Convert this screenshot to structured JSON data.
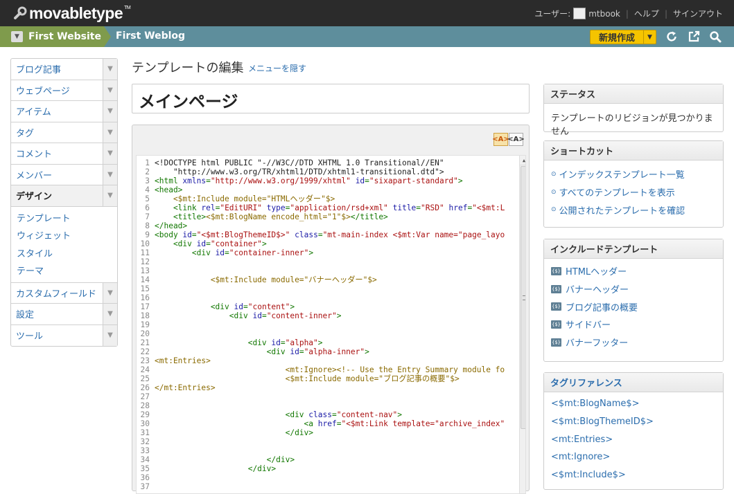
{
  "app": {
    "logo": "movabletype",
    "logo_tm": "TM"
  },
  "topnav": {
    "user_label": "ユーザー:",
    "username": "mtbook",
    "help": "ヘルプ",
    "signout": "サインアウト"
  },
  "sitebar": {
    "website": "First Website",
    "blog": "First Weblog",
    "new_button": "新規作成"
  },
  "menu": {
    "items": [
      {
        "label": "ブログ記事"
      },
      {
        "label": "ウェブページ"
      },
      {
        "label": "アイテム"
      },
      {
        "label": "タグ"
      },
      {
        "label": "コメント"
      },
      {
        "label": "メンバー"
      },
      {
        "label": "デザイン"
      }
    ],
    "design_sub": [
      "テンプレート",
      "ウィジェット",
      "スタイル",
      "テーマ"
    ],
    "items_after": [
      {
        "label": "カスタムフィールド"
      },
      {
        "label": "設定"
      },
      {
        "label": "ツール"
      }
    ]
  },
  "page": {
    "title": "テンプレートの編集",
    "hide_menu": "メニューを隠す",
    "template_name": "メインページ"
  },
  "editor": {
    "tool_on": "<A>",
    "tool_off": "<A>"
  },
  "code_lines": [
    [
      [
        "tx",
        "<!DOCTYPE html PUBLIC \"-//W3C//DTD XHTML 1.0 Transitional//EN\""
      ]
    ],
    [
      [
        "tx",
        "    \"http://www.w3.org/TR/xhtml1/DTD/xhtml1-transitional.dtd\">"
      ]
    ],
    [
      [
        "tg",
        "<html "
      ],
      [
        "at",
        "xmlns"
      ],
      [
        "tg",
        "="
      ],
      [
        "st",
        "\"http://www.w3.org/1999/xhtml\""
      ],
      [
        "tg",
        " "
      ],
      [
        "at",
        "id"
      ],
      [
        "tg",
        "="
      ],
      [
        "st",
        "\"sixapart-standard\""
      ],
      [
        "tg",
        ">"
      ]
    ],
    [
      [
        "tg",
        "<head>"
      ]
    ],
    [
      [
        "mt",
        "    <$mt:Include module=\"HTMLヘッダー\"$>"
      ]
    ],
    [
      [
        "tg",
        "    <link "
      ],
      [
        "at",
        "rel"
      ],
      [
        "tg",
        "="
      ],
      [
        "st",
        "\"EditURI\""
      ],
      [
        "tg",
        " "
      ],
      [
        "at",
        "type"
      ],
      [
        "tg",
        "="
      ],
      [
        "st",
        "\"application/rsd+xml\""
      ],
      [
        "tg",
        " "
      ],
      [
        "at",
        "title"
      ],
      [
        "tg",
        "="
      ],
      [
        "st",
        "\"RSD\""
      ],
      [
        "tg",
        " "
      ],
      [
        "at",
        "href"
      ],
      [
        "tg",
        "="
      ],
      [
        "st",
        "\"<$mt:L"
      ]
    ],
    [
      [
        "tg",
        "    <title>"
      ],
      [
        "mt",
        "<$mt:BlogName encode_html=\"1\"$>"
      ],
      [
        "tg",
        "</title>"
      ]
    ],
    [
      [
        "tg",
        "</head>"
      ]
    ],
    [
      [
        "tg",
        "<body "
      ],
      [
        "at",
        "id"
      ],
      [
        "tg",
        "="
      ],
      [
        "st",
        "\"<$mt:BlogThemeID$>\""
      ],
      [
        "tg",
        " "
      ],
      [
        "at",
        "class"
      ],
      [
        "tg",
        "="
      ],
      [
        "st",
        "\"mt-main-index <$mt:Var name=\"page_layo"
      ]
    ],
    [
      [
        "tg",
        "    <div "
      ],
      [
        "at",
        "id"
      ],
      [
        "tg",
        "="
      ],
      [
        "st",
        "\"container\""
      ],
      [
        "tg",
        ">"
      ]
    ],
    [
      [
        "tg",
        "        <div "
      ],
      [
        "at",
        "id"
      ],
      [
        "tg",
        "="
      ],
      [
        "st",
        "\"container-inner\""
      ],
      [
        "tg",
        ">"
      ]
    ],
    [],
    [],
    [
      [
        "mt",
        "            <$mt:Include module=\"バナーヘッダー\"$>"
      ]
    ],
    [],
    [],
    [
      [
        "tg",
        "            <div "
      ],
      [
        "at",
        "id"
      ],
      [
        "tg",
        "="
      ],
      [
        "st",
        "\"content\""
      ],
      [
        "tg",
        ">"
      ]
    ],
    [
      [
        "tg",
        "                <div "
      ],
      [
        "at",
        "id"
      ],
      [
        "tg",
        "="
      ],
      [
        "st",
        "\"content-inner\""
      ],
      [
        "tg",
        ">"
      ]
    ],
    [],
    [],
    [
      [
        "tg",
        "                    <div "
      ],
      [
        "at",
        "id"
      ],
      [
        "tg",
        "="
      ],
      [
        "st",
        "\"alpha\""
      ],
      [
        "tg",
        ">"
      ]
    ],
    [
      [
        "tg",
        "                        <div "
      ],
      [
        "at",
        "id"
      ],
      [
        "tg",
        "="
      ],
      [
        "st",
        "\"alpha-inner\""
      ],
      [
        "tg",
        ">"
      ]
    ],
    [
      [
        "mt",
        "<mt:Entries>"
      ]
    ],
    [
      [
        "mt",
        "                            <mt:Ignore><!-- Use the Entry Summary module fo"
      ]
    ],
    [
      [
        "mt",
        "                            <$mt:Include module=\"ブログ記事の概要\"$>"
      ]
    ],
    [
      [
        "mt",
        "</mt:Entries>"
      ]
    ],
    [],
    [],
    [
      [
        "tg",
        "                            <div "
      ],
      [
        "at",
        "class"
      ],
      [
        "tg",
        "="
      ],
      [
        "st",
        "\"content-nav\""
      ],
      [
        "tg",
        ">"
      ]
    ],
    [
      [
        "tg",
        "                                <a "
      ],
      [
        "at",
        "href"
      ],
      [
        "tg",
        "="
      ],
      [
        "st",
        "\"<$mt:Link template=\"archive_index\""
      ]
    ],
    [
      [
        "tg",
        "                            </div>"
      ]
    ],
    [],
    [],
    [
      [
        "tg",
        "                        </div>"
      ]
    ],
    [
      [
        "tg",
        "                    </div>"
      ]
    ],
    [],
    []
  ],
  "status": {
    "title": "ステータス",
    "text": "テンプレートのリビジョンが見つかりません"
  },
  "shortcuts": {
    "title": "ショートカット",
    "links": [
      "インデックステンプレート一覧",
      "すべてのテンプレートを表示",
      "公開されたテンプレートを確認"
    ]
  },
  "includes": {
    "title": "インクルードテンプレート",
    "items": [
      "HTMLヘッダー",
      "バナーヘッダー",
      "ブログ記事の概要",
      "サイドバー",
      "バナーフッター"
    ]
  },
  "tagref": {
    "title": "タグリファレンス",
    "tags": [
      "<$mt:BlogName$>",
      "<$mt:BlogThemeID$>",
      "<mt:Entries>",
      "<mt:Ignore>",
      "<$mt:Include$>"
    ]
  }
}
